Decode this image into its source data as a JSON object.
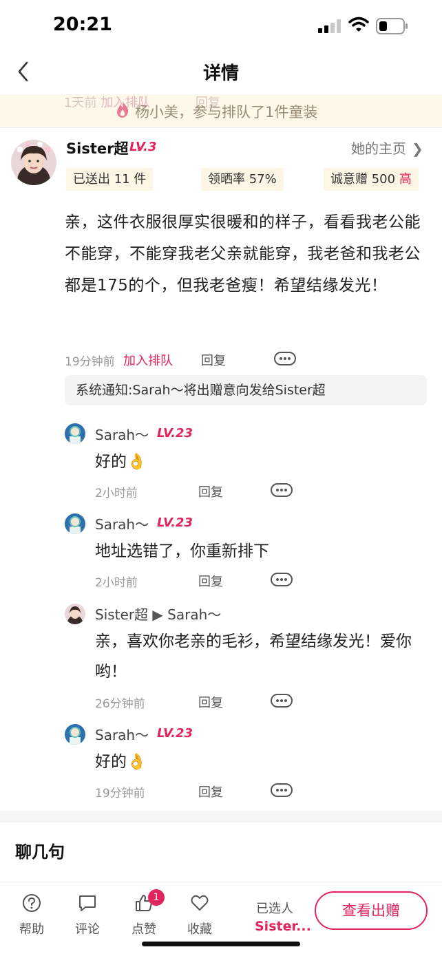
{
  "status_bar": {
    "time": "20:21"
  },
  "nav": {
    "title": "详情"
  },
  "banner": {
    "ghost_time": "1天前",
    "ghost_join": "加入排队",
    "ghost_reply": "回复",
    "text": "杨小美，参与排队了1件童装"
  },
  "post": {
    "user_name": "Sister超",
    "level": "LV.3",
    "home_link": "她的主页",
    "stats": {
      "sent": "已送出 11 件",
      "rate": "领晒率 57%",
      "sincere": "诚意赠 500",
      "sincere_tag": "高"
    },
    "body": "亲，这件衣服很厚实很暖和的样子，看看我老公能不能穿，不能穿我老父亲就能穿，我老爸和我老公都是175的个，但我老爸瘦！希望结缘发光！",
    "time": "19分钟前",
    "join_label": "加入排队",
    "reply_label": "回复",
    "system_notice": "系统通知:Sarah～将出赠意向发给Sister超"
  },
  "comments": [
    {
      "name": "Sarah～",
      "level": "LV.23",
      "text": "好的👌",
      "time": "2小时前",
      "reply": "回复"
    },
    {
      "name": "Sarah～",
      "level": "LV.23",
      "text": "地址选错了，你重新排下",
      "time": "2小时前",
      "reply": "回复"
    },
    {
      "name": "Sister超",
      "arrow": "▶",
      "to": "Sarah～",
      "text": "亲，喜欢你老亲的毛衫，希望结缘发光！爱你哟！",
      "time": "26分钟前",
      "reply": "回复"
    },
    {
      "name": "Sarah～",
      "level": "LV.23",
      "text": "好的👌",
      "time": "19分钟前",
      "reply": "回复"
    }
  ],
  "chat_heading": "聊几句",
  "bottom_bar": {
    "help": "帮助",
    "comment": "评论",
    "like": "点赞",
    "like_badge": "1",
    "favorite": "收藏",
    "selected_label": "已选人",
    "selected_name": "Sister...",
    "view_button": "查看出赠"
  },
  "colors": {
    "accent": "#e1245b",
    "banner_bg": "#fdf8e8",
    "chip_bg": "#fdf6e4"
  },
  "icons": [
    "back-icon",
    "signal-icon",
    "wifi-icon",
    "battery-icon",
    "flame-icon",
    "chevron-right-icon",
    "more-icon",
    "help-icon",
    "comment-icon",
    "like-icon",
    "favorite-icon"
  ]
}
